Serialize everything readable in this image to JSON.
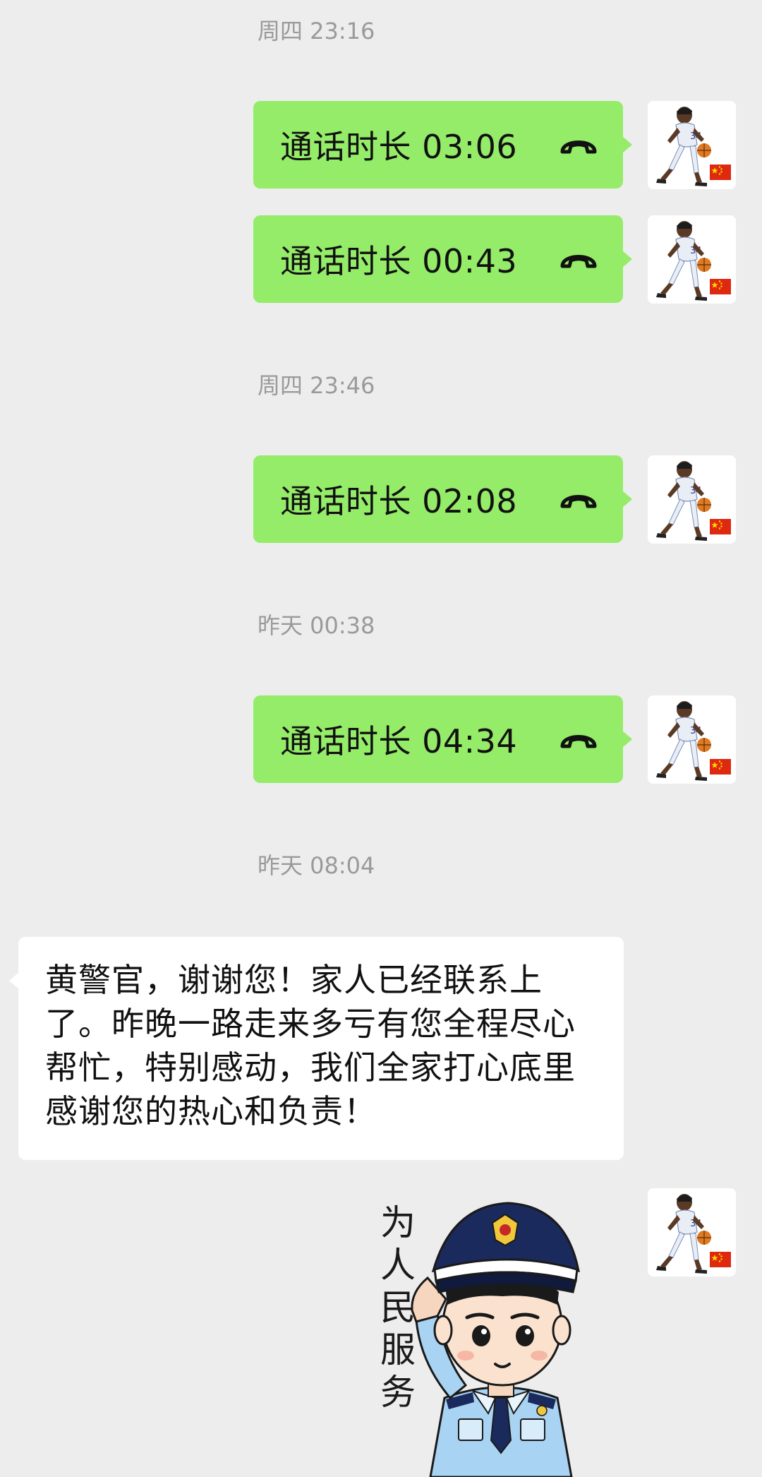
{
  "chat": {
    "messages": [
      {
        "timestamp": "周四 23:16"
      },
      {
        "call_label": "通话时长 03:06"
      },
      {
        "call_label": "通话时长 00:43"
      },
      {
        "timestamp": "周四 23:46"
      },
      {
        "call_label": "通话时长 02:08"
      },
      {
        "timestamp": "昨天 00:38"
      },
      {
        "call_label": "通话时长 04:34"
      },
      {
        "timestamp": "昨天 08:04"
      },
      {
        "text": "黄警官，谢谢您！家人已经联系上了。昨晚一路走来多亏有您全程尽心帮忙，特别感动，我们全家打心底里感谢您的热心和负责！"
      },
      {
        "sticker_text": "为人民服务"
      }
    ]
  },
  "icons": {
    "call": "phone-hangup-icon",
    "avatar": "basketball-player-avatar",
    "flag": "china-flag-icon"
  },
  "colors": {
    "background": "#ededed",
    "outgoing_bubble": "#95ec69",
    "incoming_bubble": "#ffffff",
    "timestamp_text": "#9a9a9a",
    "jersey_number": "34"
  }
}
